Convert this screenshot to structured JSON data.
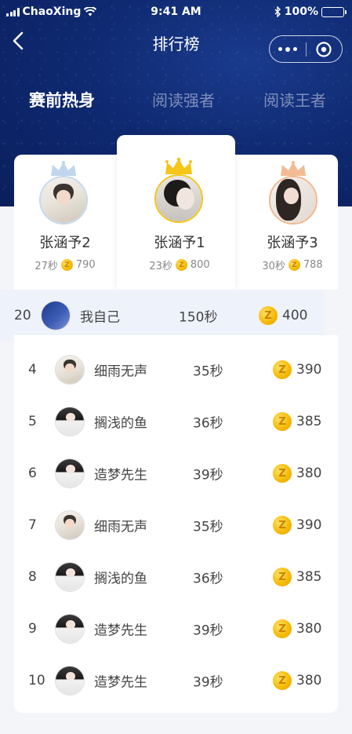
{
  "status_bar": {
    "carrier": "ChaoXing",
    "time": "9:41 AM",
    "battery": "100%"
  },
  "nav": {
    "title": "排行榜"
  },
  "tabs": [
    {
      "label": "赛前热身",
      "active": true
    },
    {
      "label": "阅读强者",
      "active": false
    },
    {
      "label": "阅读王者",
      "active": false
    }
  ],
  "podium": {
    "first": {
      "name": "张涵予1",
      "time": "23秒",
      "score": "800",
      "crown_color": "#f5c518"
    },
    "second": {
      "name": "张涵予2",
      "time": "27秒",
      "score": "790",
      "crown_color": "#b8d4f0"
    },
    "third": {
      "name": "张涵予3",
      "time": "30秒",
      "score": "788",
      "crown_color": "#f0b890"
    }
  },
  "coin_letter": "Z",
  "self": {
    "rank": "20",
    "name": "我自己",
    "time": "150秒",
    "score": "400"
  },
  "list": [
    {
      "rank": "4",
      "name": "细雨无声",
      "time": "35秒",
      "score": "390"
    },
    {
      "rank": "5",
      "name": "搁浅的鱼",
      "time": "36秒",
      "score": "385"
    },
    {
      "rank": "6",
      "name": "造梦先生",
      "time": "39秒",
      "score": "380"
    },
    {
      "rank": "7",
      "name": "细雨无声",
      "time": "35秒",
      "score": "390"
    },
    {
      "rank": "8",
      "name": "搁浅的鱼",
      "time": "36秒",
      "score": "385"
    },
    {
      "rank": "9",
      "name": "造梦先生",
      "time": "39秒",
      "score": "380"
    },
    {
      "rank": "10",
      "name": "造梦先生",
      "time": "39秒",
      "score": "380"
    }
  ]
}
